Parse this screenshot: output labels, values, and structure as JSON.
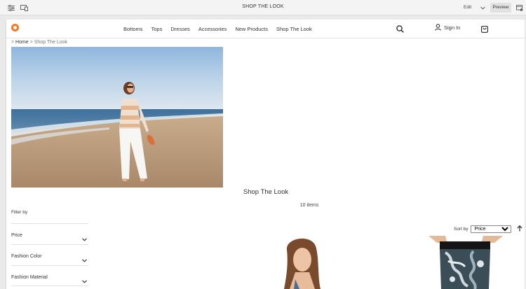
{
  "editor": {
    "title": "SHOP THE LOOK",
    "edit_label": "Edit",
    "preview_label": "Preview"
  },
  "header": {
    "nav": [
      "Bottoms",
      "Tops",
      "Dresses",
      "Accessories",
      "New Products",
      "Shop The Look"
    ],
    "signin_label": "Sign In"
  },
  "breadcrumb": {
    "prefix": ">",
    "home": "Home",
    "separator": ">",
    "current": "Shop The Look"
  },
  "page": {
    "title": "Shop The Look",
    "items_count": "10 items"
  },
  "filters": {
    "heading": "Filter by",
    "facets": [
      "Price",
      "Fashion Color",
      "Fashion Material"
    ]
  },
  "sort": {
    "label": "Sort by",
    "selected": "Price"
  },
  "colors": {
    "accent": "#f07b22"
  }
}
